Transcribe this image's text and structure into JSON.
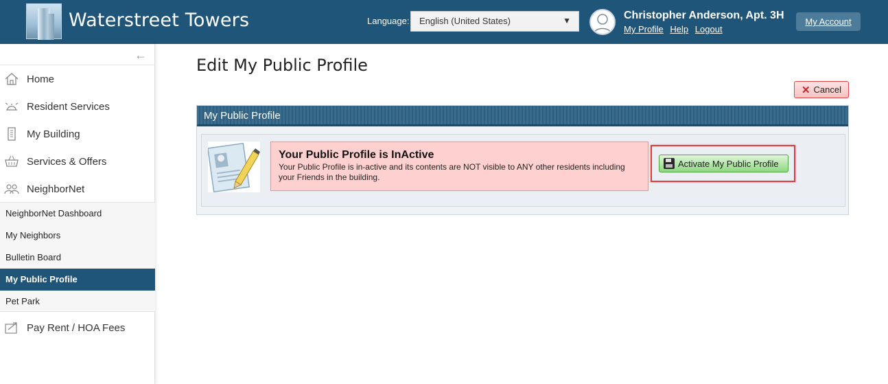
{
  "header": {
    "site_title": "Waterstreet Towers",
    "language_label": "Language:",
    "language_value": "English (United States)",
    "user_name": "Christopher Anderson, Apt. 3H",
    "links": {
      "my_profile": "My Profile",
      "help": "Help",
      "logout": "Logout"
    },
    "my_account": "My Account"
  },
  "sidebar": {
    "items": [
      {
        "label": "Home",
        "icon": "home-icon"
      },
      {
        "label": "Resident Services",
        "icon": "bell-icon"
      },
      {
        "label": "My Building",
        "icon": "building-icon"
      },
      {
        "label": "Services & Offers",
        "icon": "basket-icon"
      },
      {
        "label": "NeighborNet",
        "icon": "people-icon"
      }
    ],
    "subitems": [
      {
        "label": "NeighborNet Dashboard",
        "active": false
      },
      {
        "label": "My Neighbors",
        "active": false
      },
      {
        "label": "Bulletin Board",
        "active": false
      },
      {
        "label": "My Public Profile",
        "active": true
      },
      {
        "label": "Pet Park",
        "active": false
      }
    ],
    "bottom_item": {
      "label": "Pay Rent / HOA Fees",
      "icon": "payment-icon"
    }
  },
  "main": {
    "page_title": "Edit My Public Profile",
    "cancel_label": "Cancel",
    "panel_title": "My Public Profile",
    "notice_title": "Your Public Profile is InActive",
    "notice_text": "Your Public Profile is in-active and its contents are NOT visible to ANY other residents including your Friends in the building.",
    "activate_label": "Activate My Public Profile"
  },
  "colors": {
    "header_bg": "#1e5578",
    "active_nav_bg": "#1e5578",
    "notice_bg": "#ffd0d0",
    "activate_bg": "#8fd882",
    "highlight_border": "#e03a3a"
  }
}
